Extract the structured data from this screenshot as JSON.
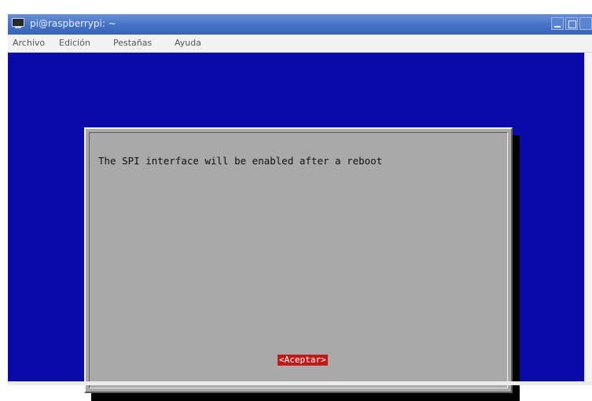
{
  "window": {
    "title": "pi@raspberrypi: ~",
    "controls": {
      "minimize": "minimize-icon",
      "maximize": "maximize-icon",
      "close": "close-icon"
    }
  },
  "menubar": {
    "items": [
      {
        "label": "Archivo"
      },
      {
        "label": "Edición"
      },
      {
        "label": "Pestañas"
      },
      {
        "label": "Ayuda"
      }
    ]
  },
  "dialog": {
    "message": "The SPI interface will be enabled after a reboot",
    "ok_label": "<Aceptar>"
  },
  "colors": {
    "terminal_bg": "#0a0aa8",
    "dialog_bg": "#a9a9a9",
    "button_selected": "#c01a1a",
    "titlebar": "#4471c6"
  }
}
